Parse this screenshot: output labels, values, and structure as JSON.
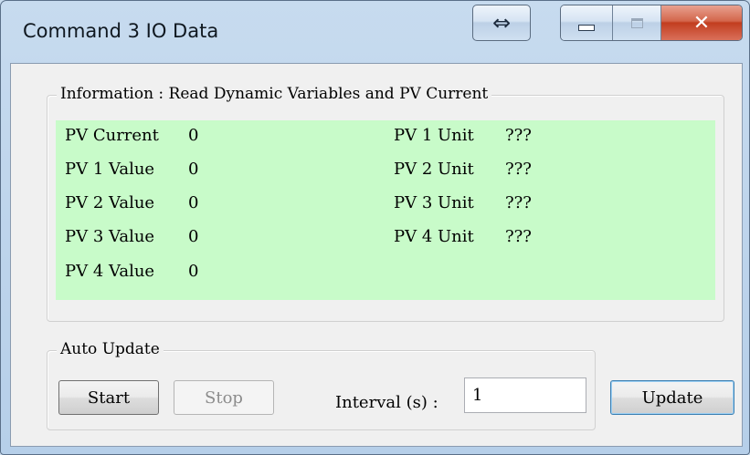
{
  "window": {
    "title": "Command 3 IO Data",
    "resize_glyph": "⇔",
    "close_glyph": "✕"
  },
  "info": {
    "legend": "Information : Read Dynamic Variables and PV Current",
    "values": [
      {
        "label": "PV Current",
        "value": "0"
      },
      {
        "label": "PV 1 Value",
        "value": "0"
      },
      {
        "label": "PV 2 Value",
        "value": "0"
      },
      {
        "label": "PV 3 Value",
        "value": "0"
      },
      {
        "label": "PV 4 Value",
        "value": "0"
      }
    ],
    "units": [
      {
        "label": "PV 1 Unit",
        "value": "???"
      },
      {
        "label": "PV 2 Unit",
        "value": "???"
      },
      {
        "label": "PV 3 Unit",
        "value": "???"
      },
      {
        "label": "PV 4 Unit",
        "value": "???"
      }
    ],
    "panel_color": "#c8fbc9"
  },
  "auto_update": {
    "legend": "Auto Update",
    "start_label": "Start",
    "stop_label": "Stop",
    "interval_label": "Interval (s) :",
    "interval_value": "1"
  },
  "update_label": "Update"
}
